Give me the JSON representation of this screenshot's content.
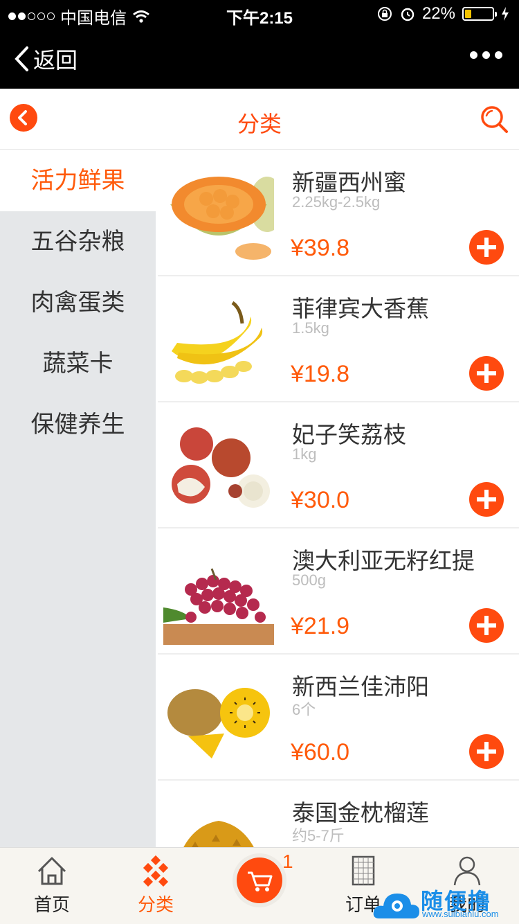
{
  "status_bar": {
    "carrier": "中国电信",
    "time": "下午2:15",
    "battery": "22%",
    "battery_level": 0.22
  },
  "nav": {
    "back_label": "返回"
  },
  "header": {
    "title": "分类"
  },
  "categories": [
    {
      "label": "活力鲜果",
      "active": true
    },
    {
      "label": "五谷杂粮",
      "active": false
    },
    {
      "label": "肉禽蛋类",
      "active": false
    },
    {
      "label": "蔬菜卡",
      "active": false
    },
    {
      "label": "保健养生",
      "active": false
    }
  ],
  "products": [
    {
      "name": "新疆西州蜜",
      "spec": "2.25kg-2.5kg",
      "price": "¥39.8",
      "image": "cantaloupe-image"
    },
    {
      "name": "菲律宾大香蕉",
      "spec": "1.5kg",
      "price": "¥19.8",
      "image": "banana-image"
    },
    {
      "name": "妃子笑荔枝",
      "spec": "1kg",
      "price": "¥30.0",
      "image": "lychee-image"
    },
    {
      "name": "澳大利亚无籽红提",
      "spec": "500g",
      "price": "¥21.9",
      "image": "grape-image"
    },
    {
      "name": "新西兰佳沛阳",
      "spec": "6个",
      "price": "¥60.0",
      "image": "kiwi-image"
    },
    {
      "name": "泰国金枕榴莲",
      "spec": "约5-7斤",
      "price": "",
      "image": "durian-image"
    }
  ],
  "tabbar": {
    "home": "首页",
    "category": "分类",
    "cart_count": "1",
    "orders": "订单",
    "mine": "我的"
  },
  "watermark": {
    "text": "随便撸",
    "url": "www.suibianlu.com"
  },
  "colors": {
    "accent": "#ff4a0f",
    "price": "#ff5a0a",
    "sidebar_bg": "#e5e7e9"
  }
}
